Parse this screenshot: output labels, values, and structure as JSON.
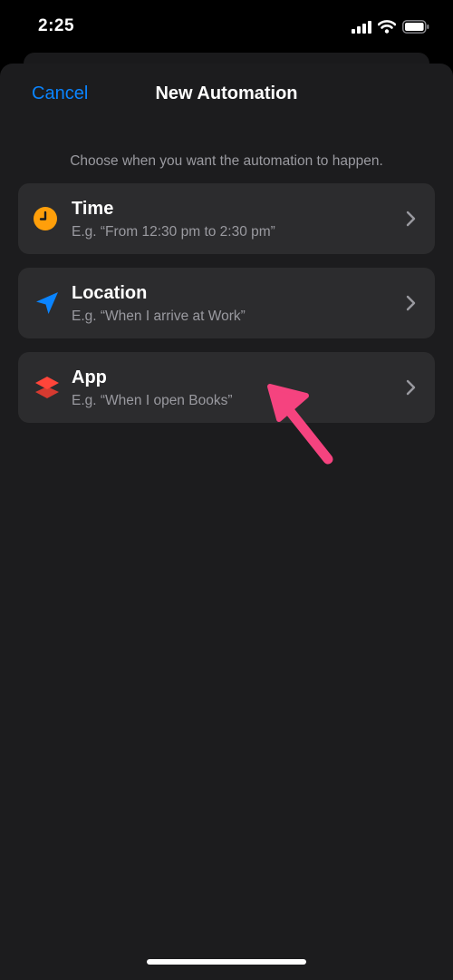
{
  "status_bar": {
    "time": "2:25"
  },
  "nav": {
    "cancel_label": "Cancel",
    "title": "New Automation"
  },
  "subtitle": "Choose when you want the automation to happen.",
  "options": [
    {
      "title": "Time",
      "subtitle": "E.g. “From 12:30 pm to 2:30 pm”",
      "icon": "clock-icon",
      "icon_color": "#ff9f0a"
    },
    {
      "title": "Location",
      "subtitle": "E.g. “When I arrive at Work”",
      "icon": "location-arrow-icon",
      "icon_color": "#0a84ff"
    },
    {
      "title": "App",
      "subtitle": "E.g. “When I open Books”",
      "icon": "app-layers-icon",
      "icon_color": "#ff453a"
    }
  ],
  "colors": {
    "accent": "#0a84ff",
    "annotation_arrow": "#f5437f"
  }
}
